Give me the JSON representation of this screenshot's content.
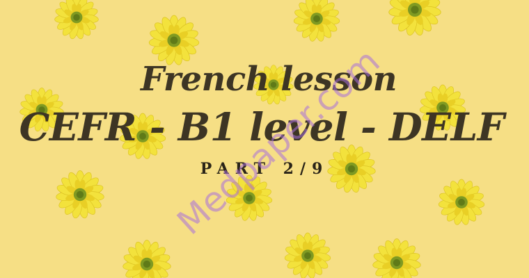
{
  "title_line1": "French lesson",
  "title_line2": "CEFR - B1 level - DELF",
  "subtitle": "PART 2/9",
  "watermark": "Medpaper.com",
  "colors": {
    "background": "#f6df85",
    "petal": "#f3e23c",
    "petal_dark": "#e9cf25",
    "center": "#7f9a22",
    "text": "#3d3524"
  }
}
